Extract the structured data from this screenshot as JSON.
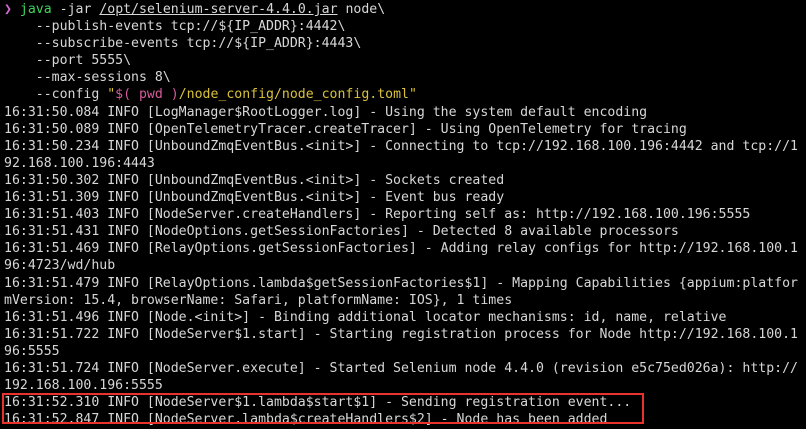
{
  "command": {
    "prompt_symbol": "❯",
    "program": "java",
    "flag_jar": "-jar",
    "jar_path": "/opt/selenium-server-4.4.0.jar",
    "subcommand": "node\\",
    "args": [
      "    --publish-events tcp://${IP_ADDR}:4442\\",
      "    --subscribe-events tcp://${IP_ADDR}:4443\\",
      "    --port 5555\\",
      "    --max-sessions 8\\"
    ],
    "config_flag": "    --config ",
    "config_quote_open": "\"",
    "config_sub": "$( pwd )",
    "config_rest": "/node_config/node_config.toml",
    "config_quote_close": "\""
  },
  "log_lines": [
    "16:31:50.084 INFO [LogManager$RootLogger.log] - Using the system default encoding",
    "16:31:50.089 INFO [OpenTelemetryTracer.createTracer] - Using OpenTelemetry for tracing",
    "16:31:50.234 INFO [UnboundZmqEventBus.<init>] - Connecting to tcp://192.168.100.196:4442 and tcp://1",
    "92.168.100.196:4443",
    "16:31:50.302 INFO [UnboundZmqEventBus.<init>] - Sockets created",
    "16:31:51.309 INFO [UnboundZmqEventBus.<init>] - Event bus ready",
    "16:31:51.403 INFO [NodeServer.createHandlers] - Reporting self as: http://192.168.100.196:5555",
    "16:31:51.431 INFO [NodeOptions.getSessionFactories] - Detected 8 available processors",
    "16:31:51.469 INFO [RelayOptions.getSessionFactories] - Adding relay configs for http://192.168.100.1",
    "96:4723/wd/hub",
    "16:31:51.479 INFO [RelayOptions.lambda$getSessionFactories$1] - Mapping Capabilities {appium:platfor",
    "mVersion: 15.4, browserName: Safari, platformName: IOS}, 1 times",
    "16:31:51.496 INFO [Node.<init>] - Binding additional locator mechanisms: id, name, relative",
    "16:31:51.722 INFO [NodeServer$1.start] - Starting registration process for Node http://192.168.100.1",
    "96:5555",
    "16:31:51.724 INFO [NodeServer.execute] - Started Selenium node 4.4.0 (revision e5c75ed026a): http://",
    "192.168.100.196:5555",
    "16:31:52.310 INFO [NodeServer$1.lambda$start$1] - Sending registration event...",
    "16:31:52.847 INFO [NodeServer.lambda$createHandlers$2] - Node has been added"
  ],
  "colors": {
    "background": "#000000",
    "text": "#d7d7d7",
    "prompt": "#d36ad0",
    "command": "#3fd35a",
    "string": "#d9c23a",
    "highlight_border": "#e8322b"
  }
}
